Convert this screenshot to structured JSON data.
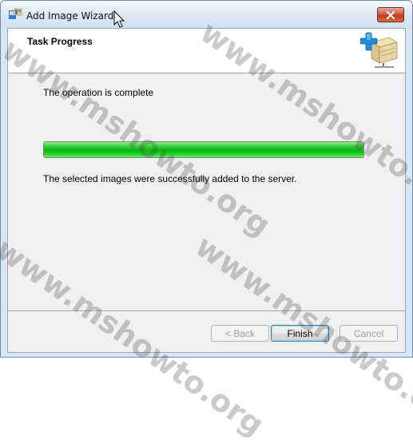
{
  "window": {
    "title": "Add Image Wizard",
    "close_label": "×"
  },
  "header": {
    "title": "Task Progress"
  },
  "main": {
    "status": "The operation is complete",
    "progress_percent": 100,
    "result": "The selected images were successfully added to the server."
  },
  "buttons": {
    "back": "< Back",
    "finish": "Finish",
    "cancel": "Cancel"
  },
  "watermark": {
    "text": "www.mshowto.org"
  },
  "colors": {
    "progress": "#1ec424",
    "close": "#c8452c"
  }
}
